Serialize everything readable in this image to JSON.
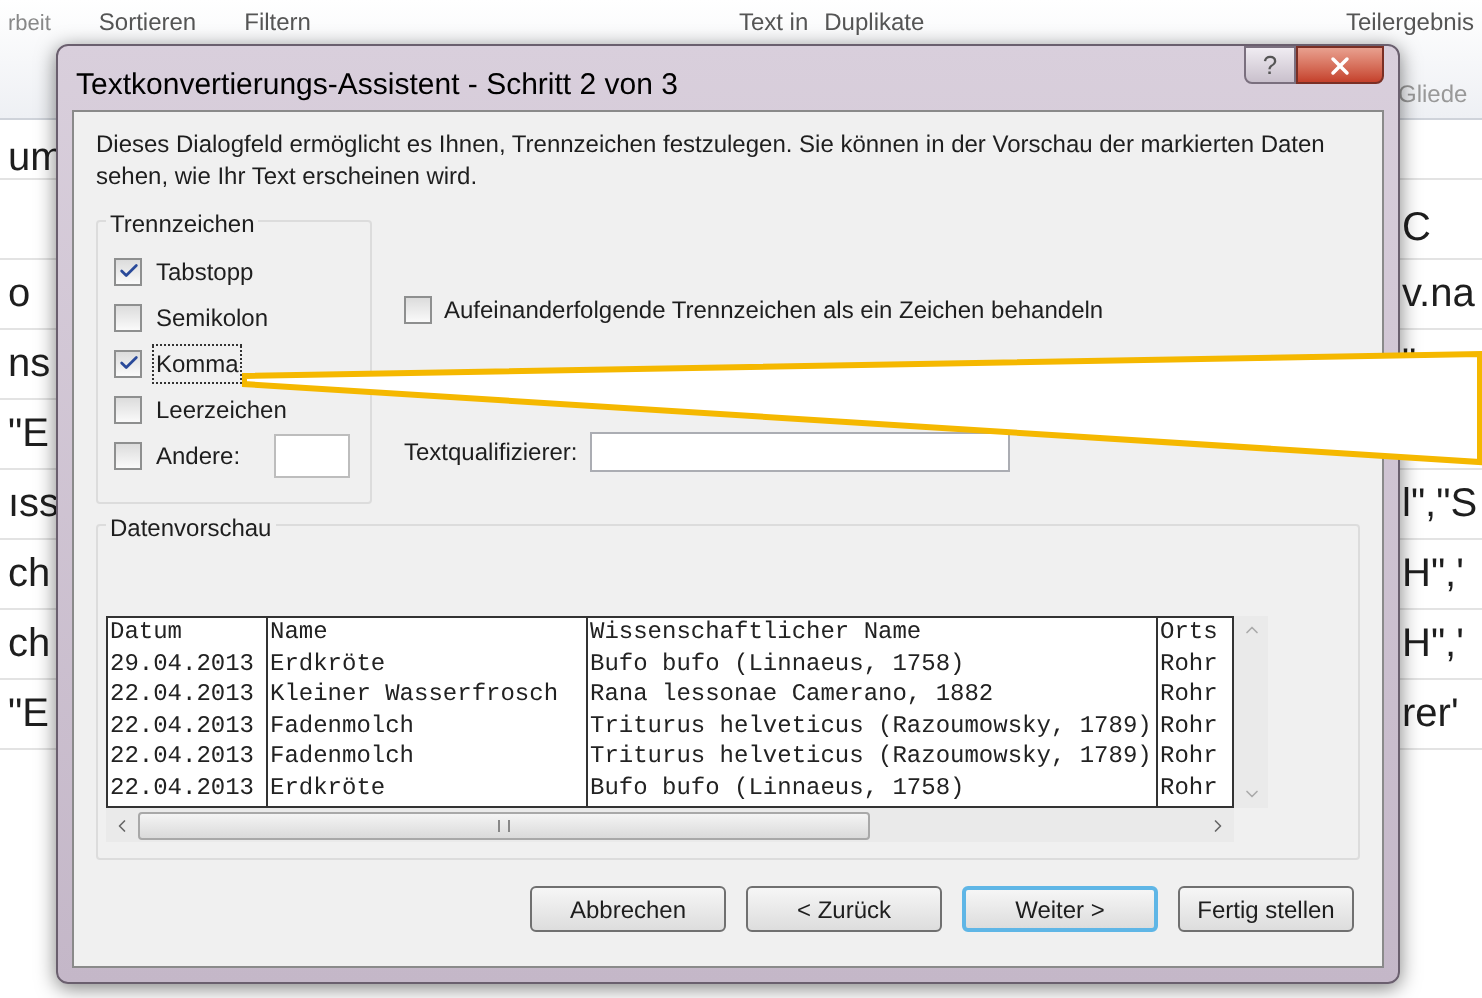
{
  "excel": {
    "ribbon": [
      "rbeit",
      "Sortieren",
      "Filtern",
      "Text in",
      "Duplikate",
      "Teilergebnis",
      "Gliede"
    ],
    "rows": [
      {
        "left": "um",
        "right": ""
      },
      {
        "left": "",
        "right": "C"
      },
      {
        "left": "o",
        "right": "v.na"
      },
      {
        "left": "ns",
        "right": "\""
      },
      {
        "left": "\"E",
        "right": ""
      },
      {
        "left": "ıss",
        "right": "l\",\"S"
      },
      {
        "left": "ch",
        "right": "H\",'"
      },
      {
        "left": "ch",
        "right": "H\",'"
      },
      {
        "left": "\"E",
        "right": "rer'"
      }
    ]
  },
  "dialog": {
    "title": "Textkonvertierungs-Assistent - Schritt 2 von 3",
    "help": "?",
    "description": "Dieses Dialogfeld ermöglicht es Ihnen, Trennzeichen festzulegen. Sie können in der Vorschau der markierten Daten sehen, wie Ihr Text erscheinen wird.",
    "delimiters": {
      "title": "Trennzeichen",
      "items": [
        {
          "label": "Tabstopp",
          "checked": true,
          "focused": false
        },
        {
          "label": "Semikolon",
          "checked": false,
          "focused": false
        },
        {
          "label": "Komma",
          "checked": true,
          "focused": true
        },
        {
          "label": "Leerzeichen",
          "checked": false,
          "focused": false
        },
        {
          "label": "Andere:",
          "checked": false,
          "focused": false,
          "kind": "input"
        }
      ]
    },
    "consecutive": {
      "label": "Aufeinanderfolgende Trennzeichen als ein Zeichen behandeln",
      "checked": false
    },
    "qualifier": {
      "label": "Textqualifizierer:"
    },
    "preview": {
      "title": "Datenvorschau",
      "rows": [
        [
          "Datum",
          "Name",
          "Wissenschaftlicher Name",
          "Orts"
        ],
        [
          "29.04.2013",
          "Erdkröte",
          "Bufo bufo (Linnaeus, 1758)",
          "Rohr"
        ],
        [
          "22.04.2013",
          "Kleiner Wasserfrosch",
          "Rana lessonae Camerano, 1882",
          "Rohr"
        ],
        [
          "22.04.2013",
          "Fadenmolch",
          "Triturus helveticus (Razoumowsky, 1789)",
          "Rohr"
        ],
        [
          "22.04.2013",
          "Fadenmolch",
          "Triturus helveticus (Razoumowsky, 1789)",
          "Rohr"
        ],
        [
          "22.04.2013",
          "Erdkröte",
          "Bufo bufo (Linnaeus, 1758)",
          "Rohr"
        ]
      ]
    },
    "buttons": [
      {
        "label": "Abbrechen",
        "default": false
      },
      {
        "label": "< Zurück",
        "default": false
      },
      {
        "label": "Weiter >",
        "default": true
      },
      {
        "label": "Fertig stellen",
        "default": false
      }
    ]
  }
}
